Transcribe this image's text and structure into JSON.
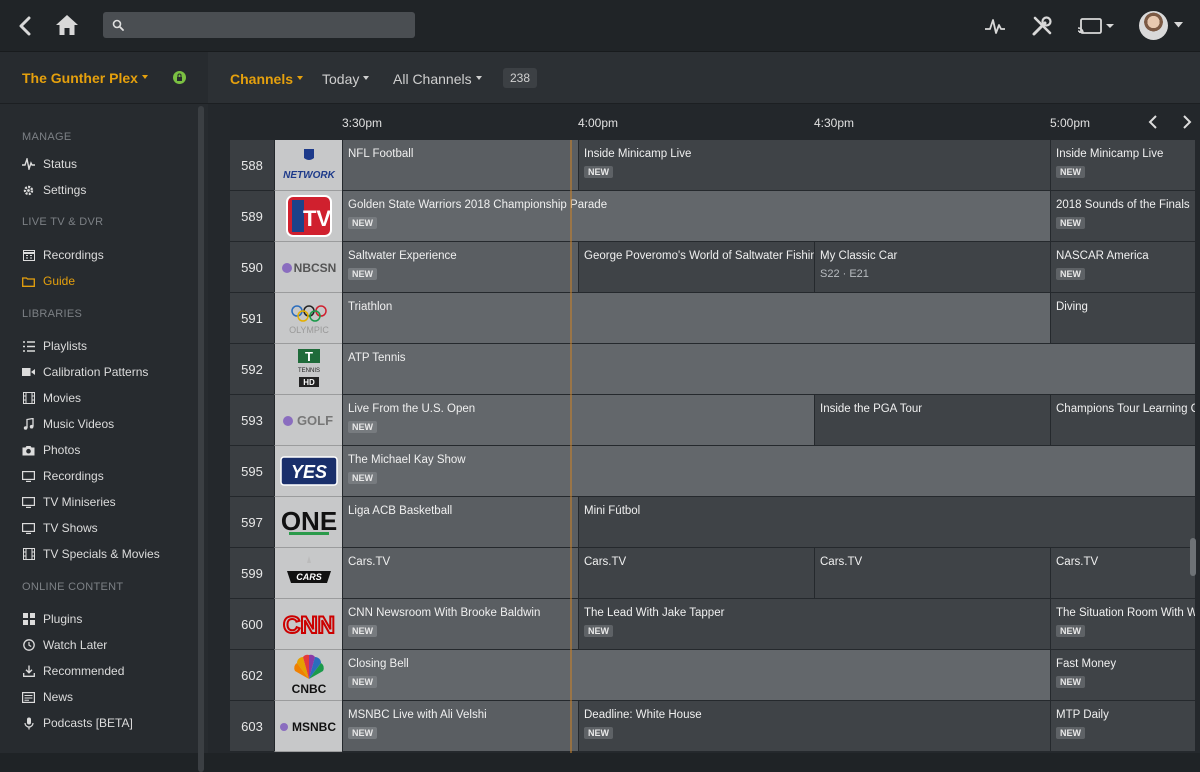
{
  "topbar": {
    "back_icon": "chevron-left-icon",
    "home_icon": "home-icon",
    "search_placeholder": "",
    "activity_icon": "activity-icon",
    "settings_icon": "tools-icon",
    "cast_icon": "cast-icon"
  },
  "sidebar": {
    "server_name": "The Gunther Plex",
    "sections": {
      "manage": "MANAGE",
      "live_tv": "LIVE TV & DVR",
      "libraries": "LIBRARIES",
      "online": "ONLINE CONTENT"
    },
    "manage_items": [
      {
        "label": "Status",
        "icon": "activity-icon"
      },
      {
        "label": "Settings",
        "icon": "gear-icon"
      }
    ],
    "live_items": [
      {
        "label": "Recordings",
        "icon": "calendar-icon"
      },
      {
        "label": "Guide",
        "icon": "folder-icon",
        "active": true
      }
    ],
    "library_items": [
      {
        "label": "Playlists",
        "icon": "list-icon"
      },
      {
        "label": "Calibration Patterns",
        "icon": "video-icon"
      },
      {
        "label": "Movies",
        "icon": "film-icon"
      },
      {
        "label": "Music Videos",
        "icon": "music-icon"
      },
      {
        "label": "Photos",
        "icon": "camera-icon"
      },
      {
        "label": "Recordings",
        "icon": "tv-icon"
      },
      {
        "label": "TV Miniseries",
        "icon": "tv-icon"
      },
      {
        "label": "TV Shows",
        "icon": "tv-icon"
      },
      {
        "label": "TV Specials & Movies",
        "icon": "film-icon"
      }
    ],
    "online_items": [
      {
        "label": "Plugins",
        "icon": "grid-icon"
      },
      {
        "label": "Watch Later",
        "icon": "clock-icon"
      },
      {
        "label": "Recommended",
        "icon": "download-icon"
      },
      {
        "label": "News",
        "icon": "news-icon"
      },
      {
        "label": "Podcasts [BETA]",
        "icon": "mic-icon"
      }
    ]
  },
  "filters": {
    "channels": "Channels",
    "today": "Today",
    "all_channels": "All Channels",
    "count": "238"
  },
  "timeline": {
    "times": [
      "3:30pm",
      "4:00pm",
      "4:30pm",
      "5:00pm"
    ]
  },
  "badge": "NEW",
  "guide": [
    {
      "num": "588",
      "logo": "NFL NETWORK",
      "programs": [
        {
          "title": "NFL Football",
          "new": false,
          "past": true,
          "start": 0,
          "span": 2
        },
        {
          "title": "Inside Minicamp Live",
          "new": true,
          "start": 2,
          "span": 4
        },
        {
          "title": "Inside Minicamp Live",
          "new": true,
          "start": 6,
          "span": 2
        }
      ]
    },
    {
      "num": "589",
      "logo": "NBA TV",
      "programs": [
        {
          "title": "Golden State Warriors 2018 Championship Parade",
          "new": true,
          "past": true,
          "start": 0,
          "span": 6,
          "cur": true
        },
        {
          "title": "2018 Sounds of the Finals",
          "new": true,
          "start": 6,
          "span": 2
        }
      ]
    },
    {
      "num": "590",
      "logo": "NBCSN",
      "programs": [
        {
          "title": "Saltwater Experience",
          "new": true,
          "past": true,
          "start": 0,
          "span": 2
        },
        {
          "title": "George Poveromo's World of Saltwater Fishing",
          "new": false,
          "start": 2,
          "span": 2
        },
        {
          "title": "My Classic Car",
          "sub": "S22 · E21",
          "start": 4,
          "span": 2
        },
        {
          "title": "NASCAR America",
          "new": true,
          "start": 6,
          "span": 2
        }
      ]
    },
    {
      "num": "591",
      "logo": "OLYMPIC",
      "programs": [
        {
          "title": "Triathlon",
          "new": false,
          "past": true,
          "start": 0,
          "span": 6,
          "cur": true
        },
        {
          "title": "Diving",
          "new": false,
          "start": 6,
          "span": 2
        }
      ]
    },
    {
      "num": "592",
      "logo": "TENNIS",
      "programs": [
        {
          "title": "ATP Tennis",
          "new": false,
          "past": true,
          "start": 0,
          "span": 8,
          "cur": true
        }
      ]
    },
    {
      "num": "593",
      "logo": "GOLF",
      "programs": [
        {
          "title": "Live From the U.S. Open",
          "new": true,
          "past": true,
          "start": 0,
          "span": 4,
          "cur": true
        },
        {
          "title": "Inside the PGA Tour",
          "new": false,
          "start": 4,
          "span": 2
        },
        {
          "title": "Champions Tour Learning Center",
          "new": false,
          "start": 6,
          "span": 2
        }
      ]
    },
    {
      "num": "595",
      "logo": "YES",
      "programs": [
        {
          "title": "The Michael Kay Show",
          "new": true,
          "past": true,
          "start": 0,
          "span": 8,
          "cur": true
        }
      ]
    },
    {
      "num": "597",
      "logo": "ONE",
      "programs": [
        {
          "title": "Liga ACB Basketball",
          "new": false,
          "past": true,
          "start": 0,
          "span": 2
        },
        {
          "title": "Mini Fútbol",
          "new": false,
          "start": 2,
          "span": 6
        }
      ]
    },
    {
      "num": "599",
      "logo": "CARS",
      "programs": [
        {
          "title": "Cars.TV",
          "new": false,
          "past": true,
          "start": 0,
          "span": 2
        },
        {
          "title": "Cars.TV",
          "new": false,
          "start": 2,
          "span": 2
        },
        {
          "title": "Cars.TV",
          "new": false,
          "start": 4,
          "span": 2
        },
        {
          "title": "Cars.TV",
          "new": false,
          "start": 6,
          "span": 2
        }
      ]
    },
    {
      "num": "600",
      "logo": "CNN",
      "programs": [
        {
          "title": "CNN Newsroom With Brooke Baldwin",
          "new": true,
          "past": true,
          "start": 0,
          "span": 2
        },
        {
          "title": "The Lead With Jake Tapper",
          "new": true,
          "start": 2,
          "span": 4
        },
        {
          "title": "The Situation Room With Wolf Blitzer",
          "new": true,
          "start": 6,
          "span": 2
        }
      ]
    },
    {
      "num": "602",
      "logo": "CNBC",
      "programs": [
        {
          "title": "Closing Bell",
          "new": true,
          "past": true,
          "start": 0,
          "span": 6,
          "cur": true
        },
        {
          "title": "Fast Money",
          "new": true,
          "start": 6,
          "span": 2
        }
      ]
    },
    {
      "num": "603",
      "logo": "MSNBC",
      "programs": [
        {
          "title": "MSNBC Live with Ali Velshi",
          "new": true,
          "past": true,
          "start": 0,
          "span": 2
        },
        {
          "title": "Deadline: White House",
          "new": true,
          "start": 2,
          "span": 4
        },
        {
          "title": "MTP Daily",
          "new": true,
          "start": 6,
          "span": 2
        }
      ]
    }
  ]
}
